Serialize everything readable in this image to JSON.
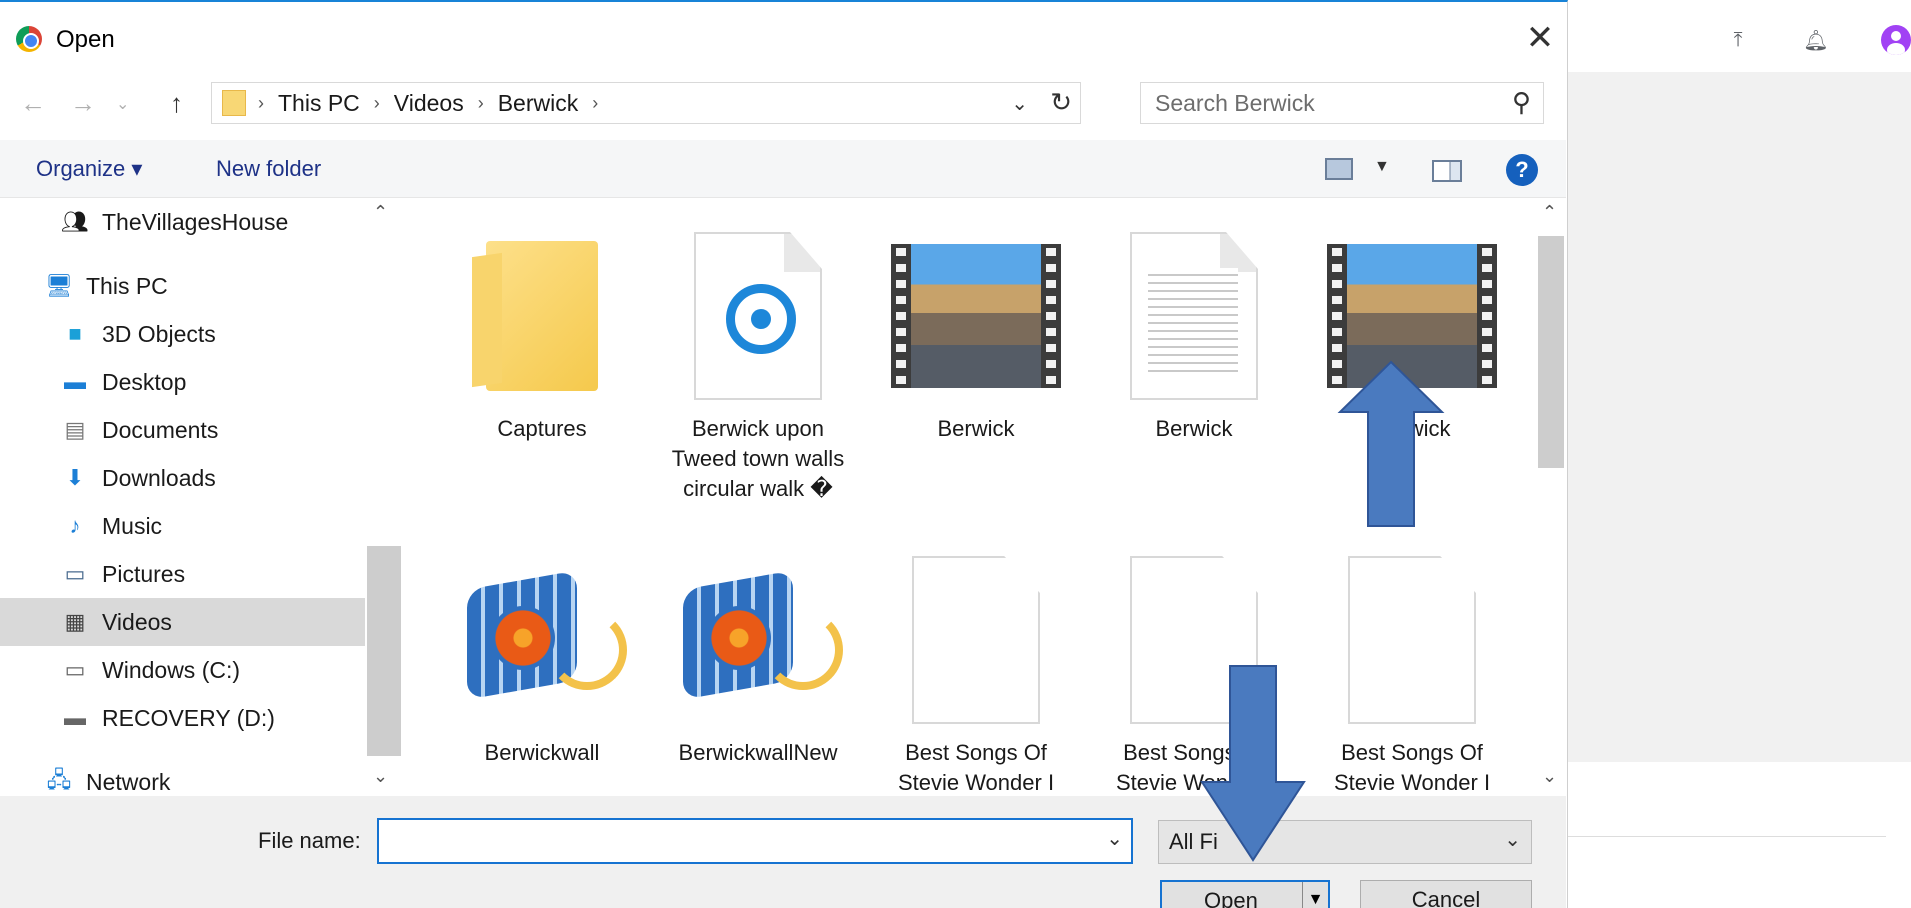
{
  "dialog": {
    "title": "Open",
    "close_icon": "close-icon"
  },
  "address_bar": {
    "breadcrumbs": [
      "This PC",
      "Videos",
      "Berwick"
    ],
    "search_placeholder": "Search Berwick"
  },
  "toolbar": {
    "organize_label": "Organize ▾",
    "new_folder_label": "New folder",
    "help_label": "?"
  },
  "nav_pane": {
    "items": [
      {
        "label": "TheVillagesHouse",
        "icon": "homegroup-icon"
      },
      {
        "label": "This PC",
        "icon": "computer-icon"
      },
      {
        "label": "3D Objects",
        "icon": "cube-icon"
      },
      {
        "label": "Desktop",
        "icon": "desktop-icon"
      },
      {
        "label": "Documents",
        "icon": "documents-icon"
      },
      {
        "label": "Downloads",
        "icon": "download-arrow-icon"
      },
      {
        "label": "Music",
        "icon": "music-note-icon"
      },
      {
        "label": "Pictures",
        "icon": "pictures-icon"
      },
      {
        "label": "Videos",
        "icon": "film-icon"
      },
      {
        "label": "Windows (C:)",
        "icon": "drive-icon"
      },
      {
        "label": "RECOVERY (D:)",
        "icon": "drive-icon"
      },
      {
        "label": "Network",
        "icon": "network-icon"
      }
    ],
    "selected": "Videos"
  },
  "files": [
    {
      "label": "Captures",
      "kind": "folder"
    },
    {
      "label": "Berwick upon Tweed town walls circular walk �",
      "kind": "groove-music"
    },
    {
      "label": "Berwick",
      "kind": "video"
    },
    {
      "label": "Berwick",
      "kind": "text-doc"
    },
    {
      "label": "Berwick",
      "kind": "video"
    },
    {
      "label": "Berwickwall",
      "kind": "movie-maker"
    },
    {
      "label": "BerwickwallNew",
      "kind": "movie-maker"
    },
    {
      "label": "Best Songs Of Stevie Wonder I",
      "kind": "blank-doc"
    },
    {
      "label": "Best Songs Of Stevie Wonder I",
      "kind": "blank-doc"
    },
    {
      "label": "Best Songs Of Stevie Wonder I",
      "kind": "blank-doc"
    }
  ],
  "bottom": {
    "file_name_label": "File name:",
    "file_name_value": "",
    "filter_value": "All Fi",
    "open_label": "Open",
    "cancel_label": "Cancel"
  },
  "colors": {
    "accent": "#1673d1",
    "annotation_arrow": "#4a7abf",
    "selected_bg": "#d9d9d9"
  }
}
